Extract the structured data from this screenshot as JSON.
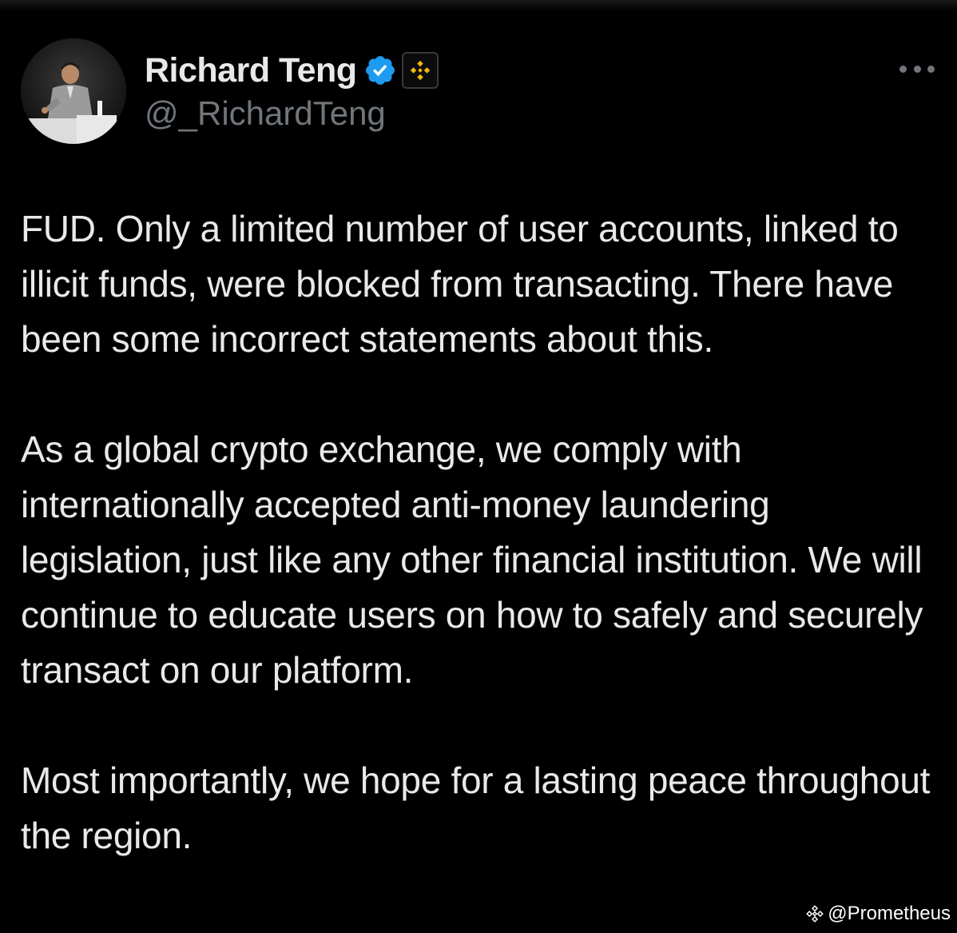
{
  "tweet": {
    "author": {
      "display_name": "Richard Teng",
      "handle": "@_RichardTeng",
      "verified_badge_icon": "verified-check-icon",
      "affiliate_badge_icon": "binance-logo-icon",
      "verified_color": "#1d9bf0",
      "affiliate_color": "#f0b90b"
    },
    "more_icon": "more-horizontal-icon",
    "paragraphs": [
      "FUD. Only a limited number of user accounts, linked to illicit funds, were blocked from transacting. There have been some incorrect statements about this.",
      "As a global crypto exchange, we comply with internationally accepted anti-money laundering legislation, just like any other financial institution. We will continue to educate users on how to safely and securely transact on our platform.",
      "Most importantly, we hope for a lasting peace throughout the region."
    ]
  },
  "watermark": {
    "icon": "binance-logo-icon",
    "text": "@Prometheus"
  },
  "colors": {
    "background": "#000000",
    "text_primary": "#e7e9ea",
    "text_secondary": "#71767b"
  }
}
